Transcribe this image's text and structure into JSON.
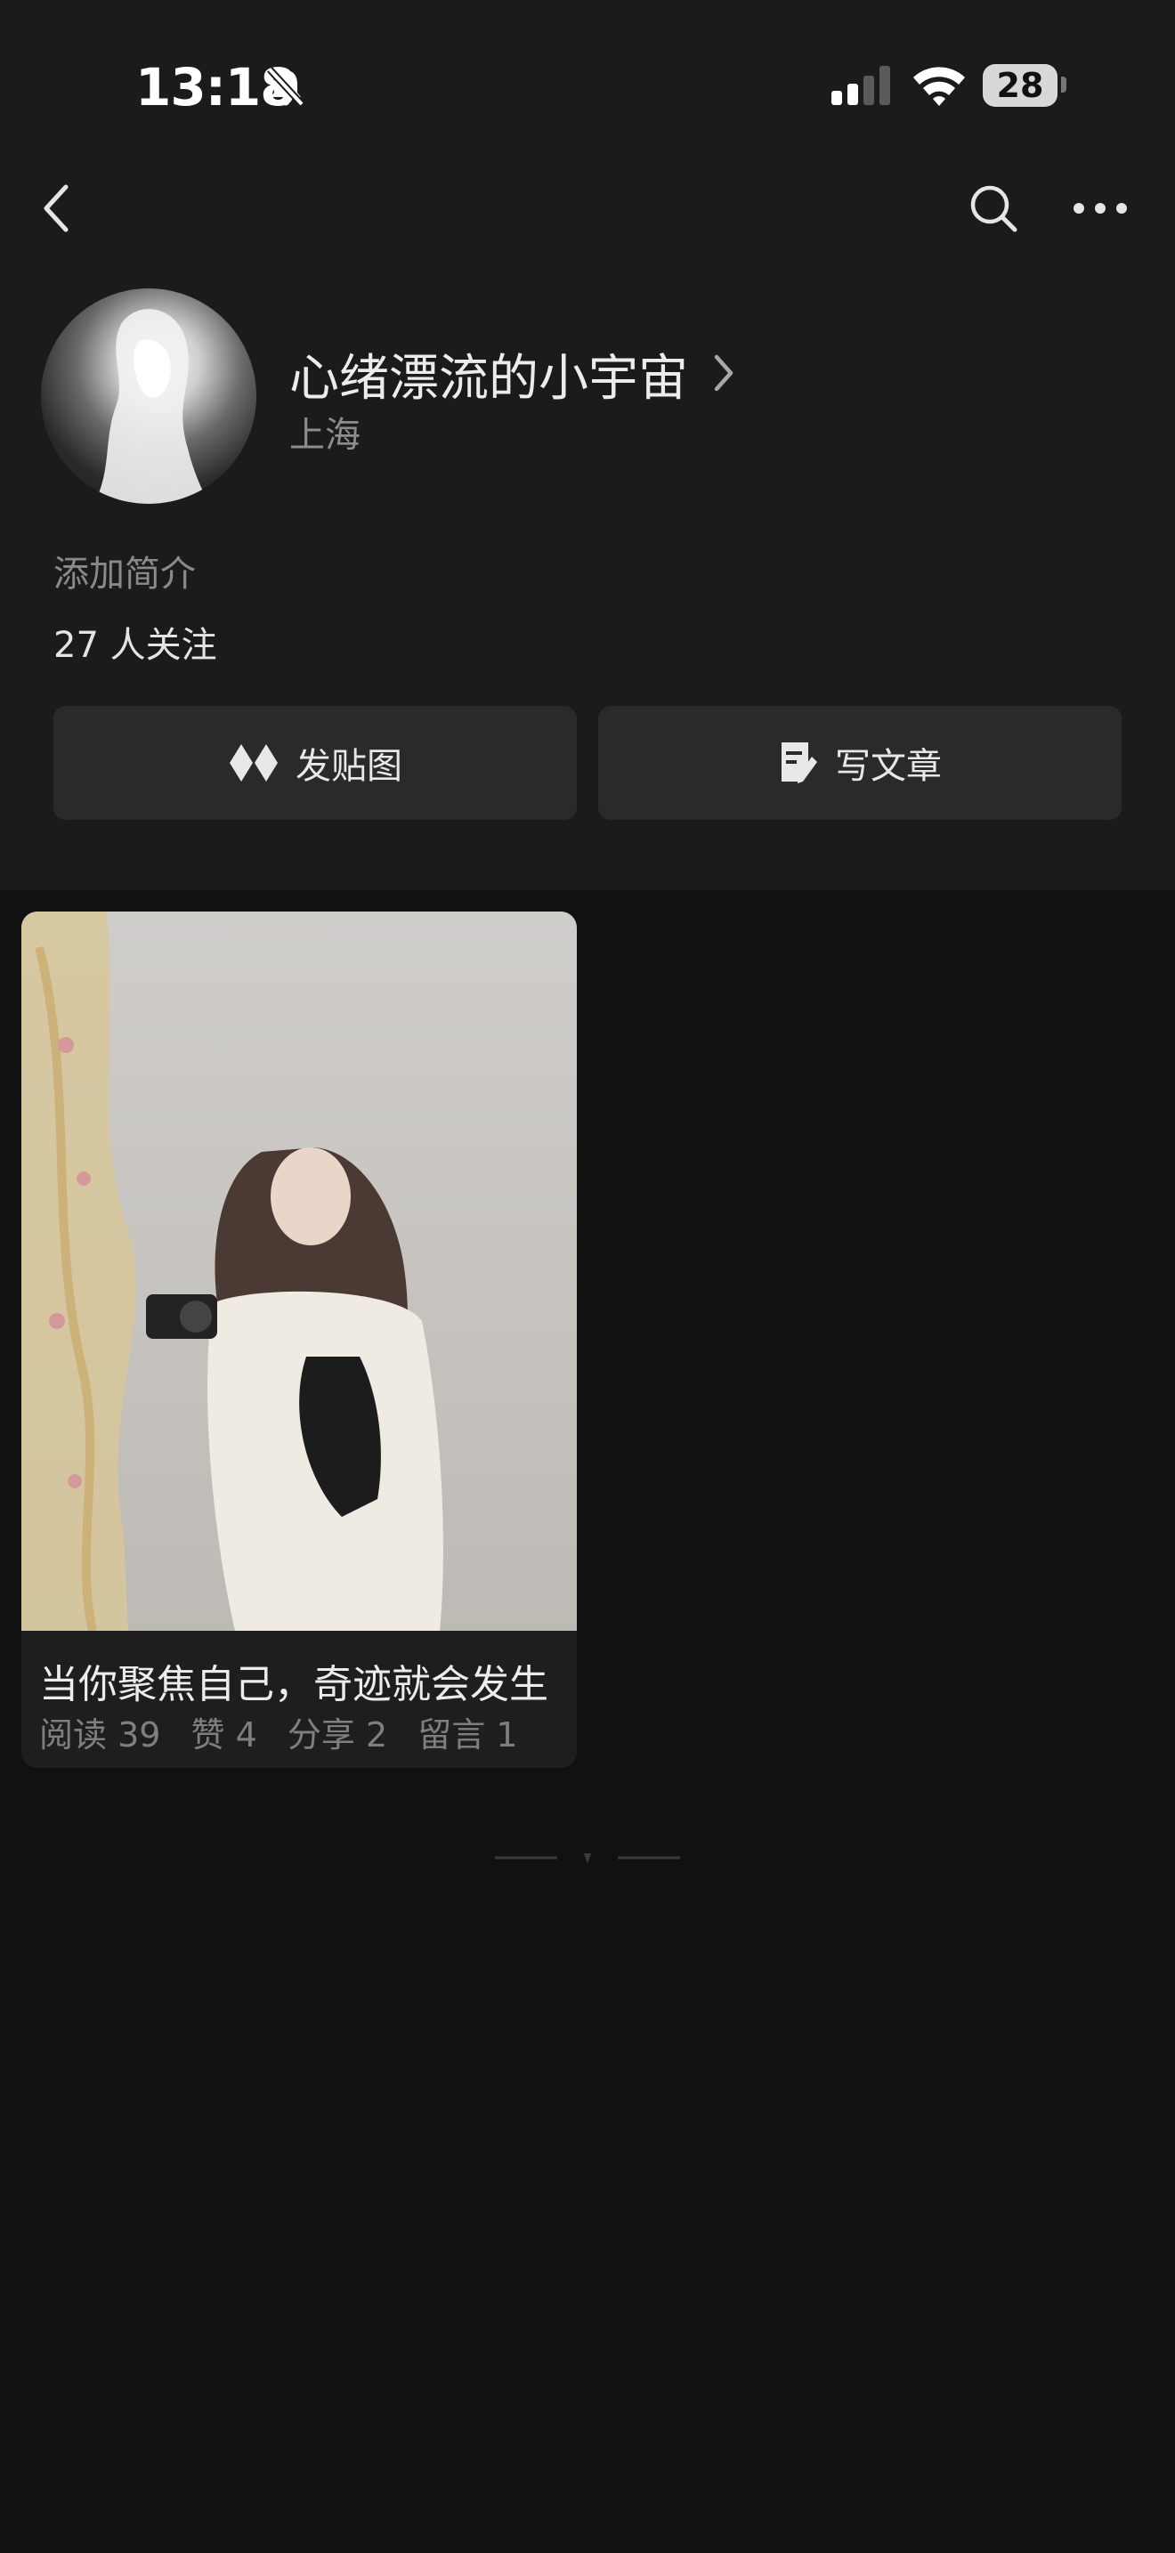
{
  "status_bar": {
    "time": "13:18",
    "battery": "28",
    "icons": [
      "bell-slash-icon",
      "signal-icon",
      "wifi-icon",
      "battery-icon"
    ]
  },
  "nav": {
    "icons": [
      "back-icon",
      "search-icon",
      "more-icon"
    ]
  },
  "profile": {
    "name": "心绪漂流的小宇宙",
    "location": "上海",
    "bio_placeholder": "添加简介",
    "followers": "27 人关注"
  },
  "actions": {
    "post_image": "发贴图",
    "write_article": "写文章"
  },
  "posts": [
    {
      "title": "当你聚焦自己，奇迹就会发生",
      "reads": "阅读 39",
      "likes": "赞 4",
      "shares": "分享 2",
      "comments": "留言 1"
    }
  ],
  "colors": {
    "header_bg": "#1b1b1c",
    "page_bg": "#111111",
    "button_bg": "#2a2a2b"
  }
}
